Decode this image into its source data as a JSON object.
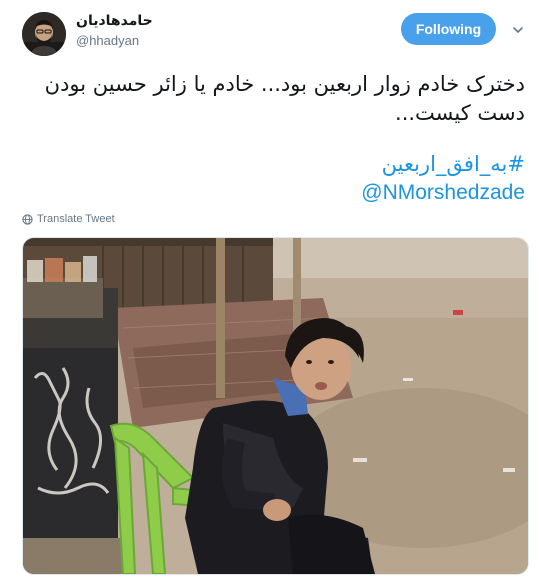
{
  "author": {
    "display_name": "حامدهادیان",
    "handle": "@hhadyan",
    "avatar_icon": "user-avatar"
  },
  "header": {
    "follow_label": "Following",
    "caret_icon": "chevron-down-icon"
  },
  "tweet": {
    "text_line1": "دخترک خادم زوار اربعین بود... خادم یا زائر حسین بودن",
    "text_line2": "دست کیست...",
    "hashtag": "#به_افق_اربعین",
    "mention": "@NMorshedzade",
    "translate_label": "Translate Tweet"
  },
  "colors": {
    "accent": "#1b95e0",
    "follow_bg": "#4aa1eb",
    "muted": "#657786"
  }
}
